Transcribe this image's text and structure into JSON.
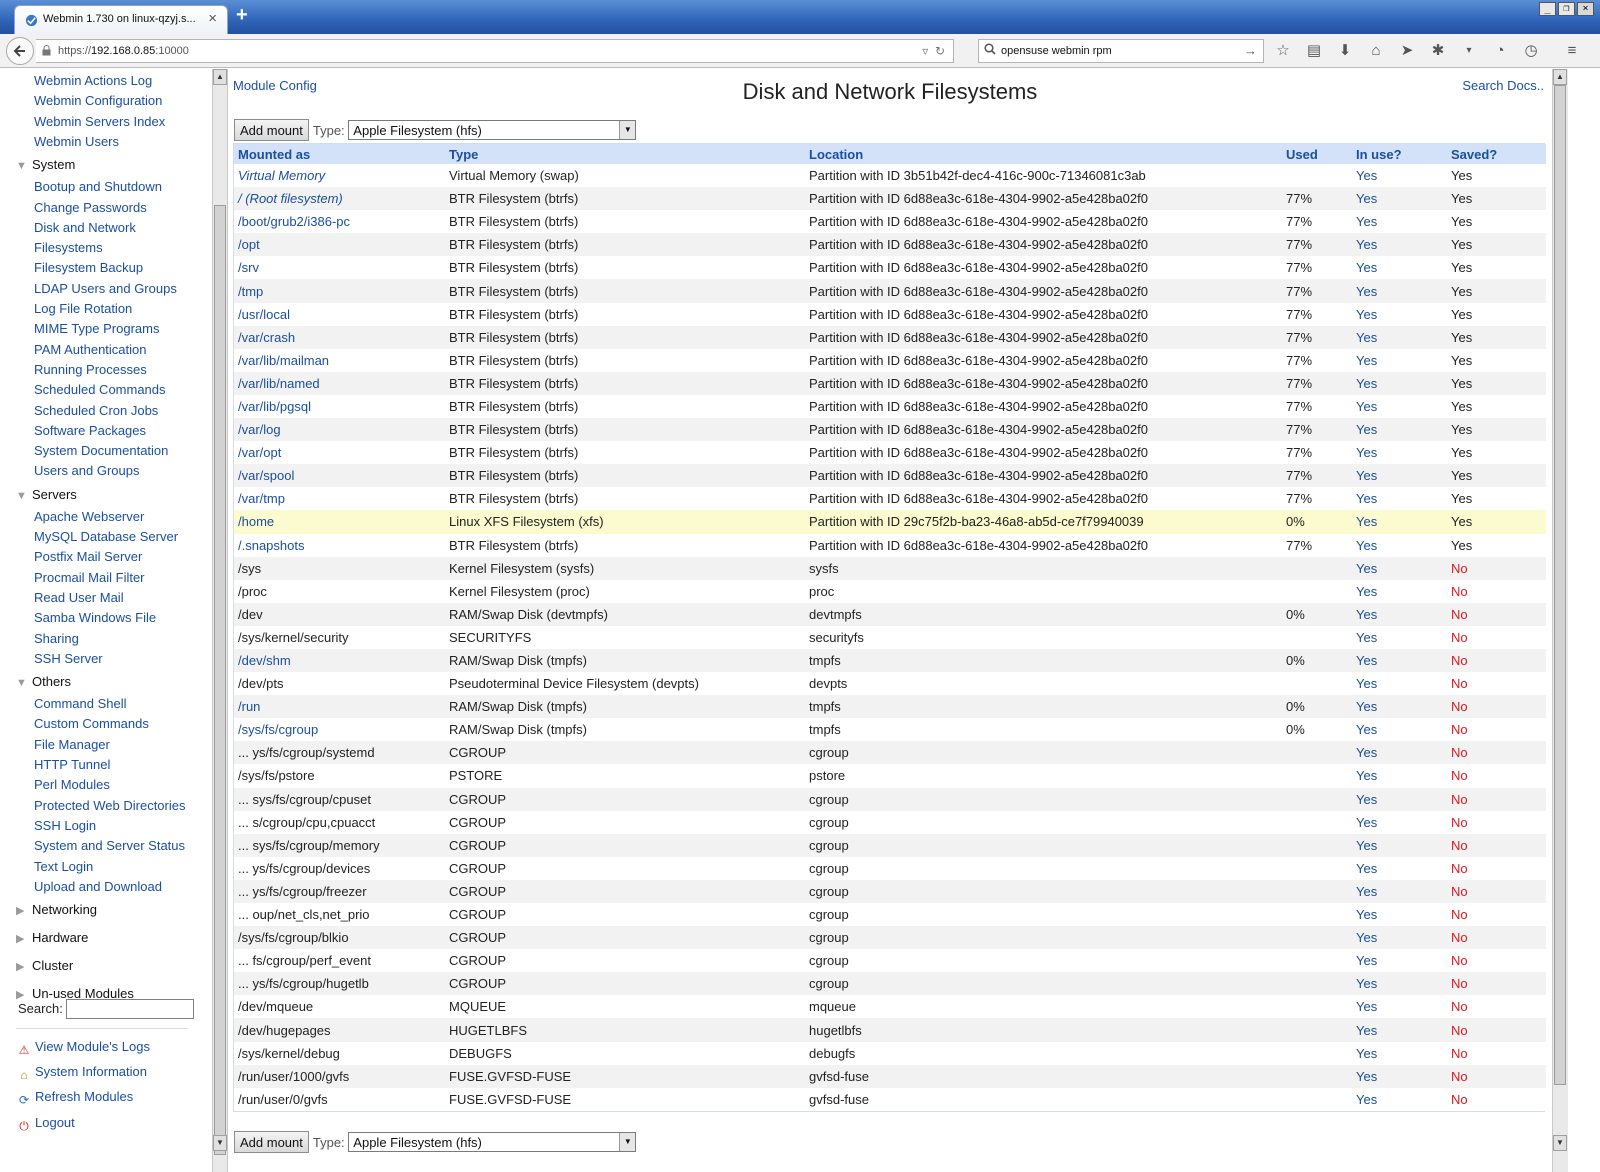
{
  "browser": {
    "tab_title": "Webmin 1.730 on linux-qzyj.s...",
    "tab_close": "×",
    "new_tab": "+",
    "url_prefix": "https://",
    "url_host": "192.168.0.85",
    "url_port": ":10000",
    "search_value": "opensuse webmin rpm",
    "window_controls": [
      "_",
      "❐",
      "×"
    ],
    "toolbar_icons": [
      "star-icon",
      "reading-list-icon",
      "download-icon",
      "home-icon",
      "send-icon",
      "addon-icon",
      "dropdown-icon",
      "sync-icon",
      "clock-icon",
      "menu-icon"
    ]
  },
  "sidebar": {
    "top_links": [
      "Webmin Actions Log",
      "Webmin Configuration",
      "Webmin Servers Index",
      "Webmin Users"
    ],
    "categories": [
      {
        "label": "System",
        "expanded": true,
        "items": [
          "Bootup and Shutdown",
          "Change Passwords",
          "Disk and Network",
          "Filesystems",
          "Filesystem Backup",
          "LDAP Users and Groups",
          "Log File Rotation",
          "MIME Type Programs",
          "PAM Authentication",
          "Running Processes",
          "Scheduled Commands",
          "Scheduled Cron Jobs",
          "Software Packages",
          "System Documentation",
          "Users and Groups"
        ]
      },
      {
        "label": "Servers",
        "expanded": true,
        "items": [
          "Apache Webserver",
          "MySQL Database Server",
          "Postfix Mail Server",
          "Procmail Mail Filter",
          "Read User Mail",
          "Samba Windows File",
          "Sharing",
          "SSH Server"
        ]
      },
      {
        "label": "Others",
        "expanded": true,
        "items": [
          "Command Shell",
          "Custom Commands",
          "File Manager",
          "HTTP Tunnel",
          "Perl Modules",
          "Protected Web Directories",
          "SSH Login",
          "System and Server Status",
          "Text Login",
          "Upload and Download"
        ]
      },
      {
        "label": "Networking",
        "expanded": false,
        "items": []
      },
      {
        "label": "Hardware",
        "expanded": false,
        "items": []
      },
      {
        "label": "Cluster",
        "expanded": false,
        "items": []
      },
      {
        "label": "Un-used Modules",
        "expanded": false,
        "items": []
      }
    ],
    "search_label": "Search:",
    "search_value": "",
    "actions": [
      {
        "label": "View Module's Logs",
        "icon": "warning-icon",
        "color": "#d12a1d"
      },
      {
        "label": "System Information",
        "icon": "home-icon",
        "color": "#c7871e"
      },
      {
        "label": "Refresh Modules",
        "icon": "refresh-icon",
        "color": "#2b67c4"
      },
      {
        "label": "Logout",
        "icon": "power-icon",
        "color": "#d12a1d"
      }
    ]
  },
  "main": {
    "module_config": "Module Config",
    "title": "Disk and Network Filesystems",
    "search_docs": "Search Docs..",
    "add_mount_label": "Add mount",
    "type_label": "Type:",
    "type_selected": "Apple Filesystem (hfs)",
    "columns": [
      "Mounted as",
      "Type",
      "Location",
      "Used",
      "In use?",
      "Saved?"
    ],
    "rows": [
      {
        "mount": "Virtual Memory",
        "link": true,
        "italic": true,
        "type": "Virtual Memory (swap)",
        "location": "Partition with ID 3b51b42f-dec4-416c-900c-71346081c3ab",
        "used": "",
        "inuse": "Yes",
        "saved": "Yes"
      },
      {
        "mount": "/ (Root filesystem)",
        "link": true,
        "italic": true,
        "type": "BTR Filesystem (btrfs)",
        "location": "Partition with ID 6d88ea3c-618e-4304-9902-a5e428ba02f0",
        "used": "77%",
        "inuse": "Yes",
        "saved": "Yes"
      },
      {
        "mount": "/boot/grub2/i386-pc",
        "link": true,
        "italic": false,
        "type": "BTR Filesystem (btrfs)",
        "location": "Partition with ID 6d88ea3c-618e-4304-9902-a5e428ba02f0",
        "used": "77%",
        "inuse": "Yes",
        "saved": "Yes"
      },
      {
        "mount": "/opt",
        "link": true,
        "italic": false,
        "type": "BTR Filesystem (btrfs)",
        "location": "Partition with ID 6d88ea3c-618e-4304-9902-a5e428ba02f0",
        "used": "77%",
        "inuse": "Yes",
        "saved": "Yes"
      },
      {
        "mount": "/srv",
        "link": true,
        "italic": false,
        "type": "BTR Filesystem (btrfs)",
        "location": "Partition with ID 6d88ea3c-618e-4304-9902-a5e428ba02f0",
        "used": "77%",
        "inuse": "Yes",
        "saved": "Yes"
      },
      {
        "mount": "/tmp",
        "link": true,
        "italic": false,
        "type": "BTR Filesystem (btrfs)",
        "location": "Partition with ID 6d88ea3c-618e-4304-9902-a5e428ba02f0",
        "used": "77%",
        "inuse": "Yes",
        "saved": "Yes"
      },
      {
        "mount": "/usr/local",
        "link": true,
        "italic": false,
        "type": "BTR Filesystem (btrfs)",
        "location": "Partition with ID 6d88ea3c-618e-4304-9902-a5e428ba02f0",
        "used": "77%",
        "inuse": "Yes",
        "saved": "Yes"
      },
      {
        "mount": "/var/crash",
        "link": true,
        "italic": false,
        "type": "BTR Filesystem (btrfs)",
        "location": "Partition with ID 6d88ea3c-618e-4304-9902-a5e428ba02f0",
        "used": "77%",
        "inuse": "Yes",
        "saved": "Yes"
      },
      {
        "mount": "/var/lib/mailman",
        "link": true,
        "italic": false,
        "type": "BTR Filesystem (btrfs)",
        "location": "Partition with ID 6d88ea3c-618e-4304-9902-a5e428ba02f0",
        "used": "77%",
        "inuse": "Yes",
        "saved": "Yes"
      },
      {
        "mount": "/var/lib/named",
        "link": true,
        "italic": false,
        "type": "BTR Filesystem (btrfs)",
        "location": "Partition with ID 6d88ea3c-618e-4304-9902-a5e428ba02f0",
        "used": "77%",
        "inuse": "Yes",
        "saved": "Yes"
      },
      {
        "mount": "/var/lib/pgsql",
        "link": true,
        "italic": false,
        "type": "BTR Filesystem (btrfs)",
        "location": "Partition with ID 6d88ea3c-618e-4304-9902-a5e428ba02f0",
        "used": "77%",
        "inuse": "Yes",
        "saved": "Yes"
      },
      {
        "mount": "/var/log",
        "link": true,
        "italic": false,
        "type": "BTR Filesystem (btrfs)",
        "location": "Partition with ID 6d88ea3c-618e-4304-9902-a5e428ba02f0",
        "used": "77%",
        "inuse": "Yes",
        "saved": "Yes"
      },
      {
        "mount": "/var/opt",
        "link": true,
        "italic": false,
        "type": "BTR Filesystem (btrfs)",
        "location": "Partition with ID 6d88ea3c-618e-4304-9902-a5e428ba02f0",
        "used": "77%",
        "inuse": "Yes",
        "saved": "Yes"
      },
      {
        "mount": "/var/spool",
        "link": true,
        "italic": false,
        "type": "BTR Filesystem (btrfs)",
        "location": "Partition with ID 6d88ea3c-618e-4304-9902-a5e428ba02f0",
        "used": "77%",
        "inuse": "Yes",
        "saved": "Yes"
      },
      {
        "mount": "/var/tmp",
        "link": true,
        "italic": false,
        "type": "BTR Filesystem (btrfs)",
        "location": "Partition with ID 6d88ea3c-618e-4304-9902-a5e428ba02f0",
        "used": "77%",
        "inuse": "Yes",
        "saved": "Yes"
      },
      {
        "mount": "/home",
        "link": true,
        "italic": false,
        "highlight": true,
        "type": "Linux XFS Filesystem (xfs)",
        "location": "Partition with ID 29c75f2b-ba23-46a8-ab5d-ce7f79940039",
        "used": "0%",
        "inuse": "Yes",
        "saved": "Yes"
      },
      {
        "mount": "/.snapshots",
        "link": true,
        "italic": false,
        "type": "BTR Filesystem (btrfs)",
        "location": "Partition with ID 6d88ea3c-618e-4304-9902-a5e428ba02f0",
        "used": "77%",
        "inuse": "Yes",
        "saved": "Yes"
      },
      {
        "mount": "/sys",
        "link": false,
        "italic": false,
        "type": "Kernel Filesystem (sysfs)",
        "location": "sysfs",
        "used": "",
        "inuse": "Yes",
        "saved": "No"
      },
      {
        "mount": "/proc",
        "link": false,
        "italic": false,
        "type": "Kernel Filesystem (proc)",
        "location": "proc",
        "used": "",
        "inuse": "Yes",
        "saved": "No"
      },
      {
        "mount": "/dev",
        "link": false,
        "italic": false,
        "type": "RAM/Swap Disk (devtmpfs)",
        "location": "devtmpfs",
        "used": "0%",
        "inuse": "Yes",
        "saved": "No"
      },
      {
        "mount": "/sys/kernel/security",
        "link": false,
        "italic": false,
        "type": "SECURITYFS",
        "location": "securityfs",
        "used": "",
        "inuse": "Yes",
        "saved": "No"
      },
      {
        "mount": "/dev/shm",
        "link": true,
        "italic": false,
        "type": "RAM/Swap Disk (tmpfs)",
        "location": "tmpfs",
        "used": "0%",
        "inuse": "Yes",
        "saved": "No"
      },
      {
        "mount": "/dev/pts",
        "link": false,
        "italic": false,
        "type": "Pseudoterminal Device Filesystem (devpts)",
        "location": "devpts",
        "used": "",
        "inuse": "Yes",
        "saved": "No"
      },
      {
        "mount": "/run",
        "link": true,
        "italic": false,
        "type": "RAM/Swap Disk (tmpfs)",
        "location": "tmpfs",
        "used": "0%",
        "inuse": "Yes",
        "saved": "No"
      },
      {
        "mount": "/sys/fs/cgroup",
        "link": true,
        "italic": false,
        "type": "RAM/Swap Disk (tmpfs)",
        "location": "tmpfs",
        "used": "0%",
        "inuse": "Yes",
        "saved": "No"
      },
      {
        "mount": "... ys/fs/cgroup/systemd",
        "link": false,
        "italic": false,
        "type": "CGROUP",
        "location": "cgroup",
        "used": "",
        "inuse": "Yes",
        "saved": "No"
      },
      {
        "mount": "/sys/fs/pstore",
        "link": false,
        "italic": false,
        "type": "PSTORE",
        "location": "pstore",
        "used": "",
        "inuse": "Yes",
        "saved": "No"
      },
      {
        "mount": "... sys/fs/cgroup/cpuset",
        "link": false,
        "italic": false,
        "type": "CGROUP",
        "location": "cgroup",
        "used": "",
        "inuse": "Yes",
        "saved": "No"
      },
      {
        "mount": "... s/cgroup/cpu,cpuacct",
        "link": false,
        "italic": false,
        "type": "CGROUP",
        "location": "cgroup",
        "used": "",
        "inuse": "Yes",
        "saved": "No"
      },
      {
        "mount": "... sys/fs/cgroup/memory",
        "link": false,
        "italic": false,
        "type": "CGROUP",
        "location": "cgroup",
        "used": "",
        "inuse": "Yes",
        "saved": "No"
      },
      {
        "mount": "... ys/fs/cgroup/devices",
        "link": false,
        "italic": false,
        "type": "CGROUP",
        "location": "cgroup",
        "used": "",
        "inuse": "Yes",
        "saved": "No"
      },
      {
        "mount": "... ys/fs/cgroup/freezer",
        "link": false,
        "italic": false,
        "type": "CGROUP",
        "location": "cgroup",
        "used": "",
        "inuse": "Yes",
        "saved": "No"
      },
      {
        "mount": "... oup/net_cls,net_prio",
        "link": false,
        "italic": false,
        "type": "CGROUP",
        "location": "cgroup",
        "used": "",
        "inuse": "Yes",
        "saved": "No"
      },
      {
        "mount": "/sys/fs/cgroup/blkio",
        "link": false,
        "italic": false,
        "type": "CGROUP",
        "location": "cgroup",
        "used": "",
        "inuse": "Yes",
        "saved": "No"
      },
      {
        "mount": "... fs/cgroup/perf_event",
        "link": false,
        "italic": false,
        "type": "CGROUP",
        "location": "cgroup",
        "used": "",
        "inuse": "Yes",
        "saved": "No"
      },
      {
        "mount": "... ys/fs/cgroup/hugetlb",
        "link": false,
        "italic": false,
        "type": "CGROUP",
        "location": "cgroup",
        "used": "",
        "inuse": "Yes",
        "saved": "No"
      },
      {
        "mount": "/dev/mqueue",
        "link": false,
        "italic": false,
        "type": "MQUEUE",
        "location": "mqueue",
        "used": "",
        "inuse": "Yes",
        "saved": "No"
      },
      {
        "mount": "/dev/hugepages",
        "link": false,
        "italic": false,
        "type": "HUGETLBFS",
        "location": "hugetlbfs",
        "used": "",
        "inuse": "Yes",
        "saved": "No"
      },
      {
        "mount": "/sys/kernel/debug",
        "link": false,
        "italic": false,
        "type": "DEBUGFS",
        "location": "debugfs",
        "used": "",
        "inuse": "Yes",
        "saved": "No"
      },
      {
        "mount": "/run/user/1000/gvfs",
        "link": false,
        "italic": false,
        "type": "FUSE.GVFSD-FUSE",
        "location": "gvfsd-fuse",
        "used": "",
        "inuse": "Yes",
        "saved": "No"
      },
      {
        "mount": "/run/user/0/gvfs",
        "link": false,
        "italic": false,
        "type": "FUSE.GVFSD-FUSE",
        "location": "gvfsd-fuse",
        "used": "",
        "inuse": "Yes",
        "saved": "No"
      }
    ]
  },
  "colors": {
    "link": "#1b4fa1",
    "header_bg": "#d3e2f8",
    "row_alt": "#f2f2f2",
    "highlight": "#fbfbcf",
    "no": "#e0191f"
  }
}
